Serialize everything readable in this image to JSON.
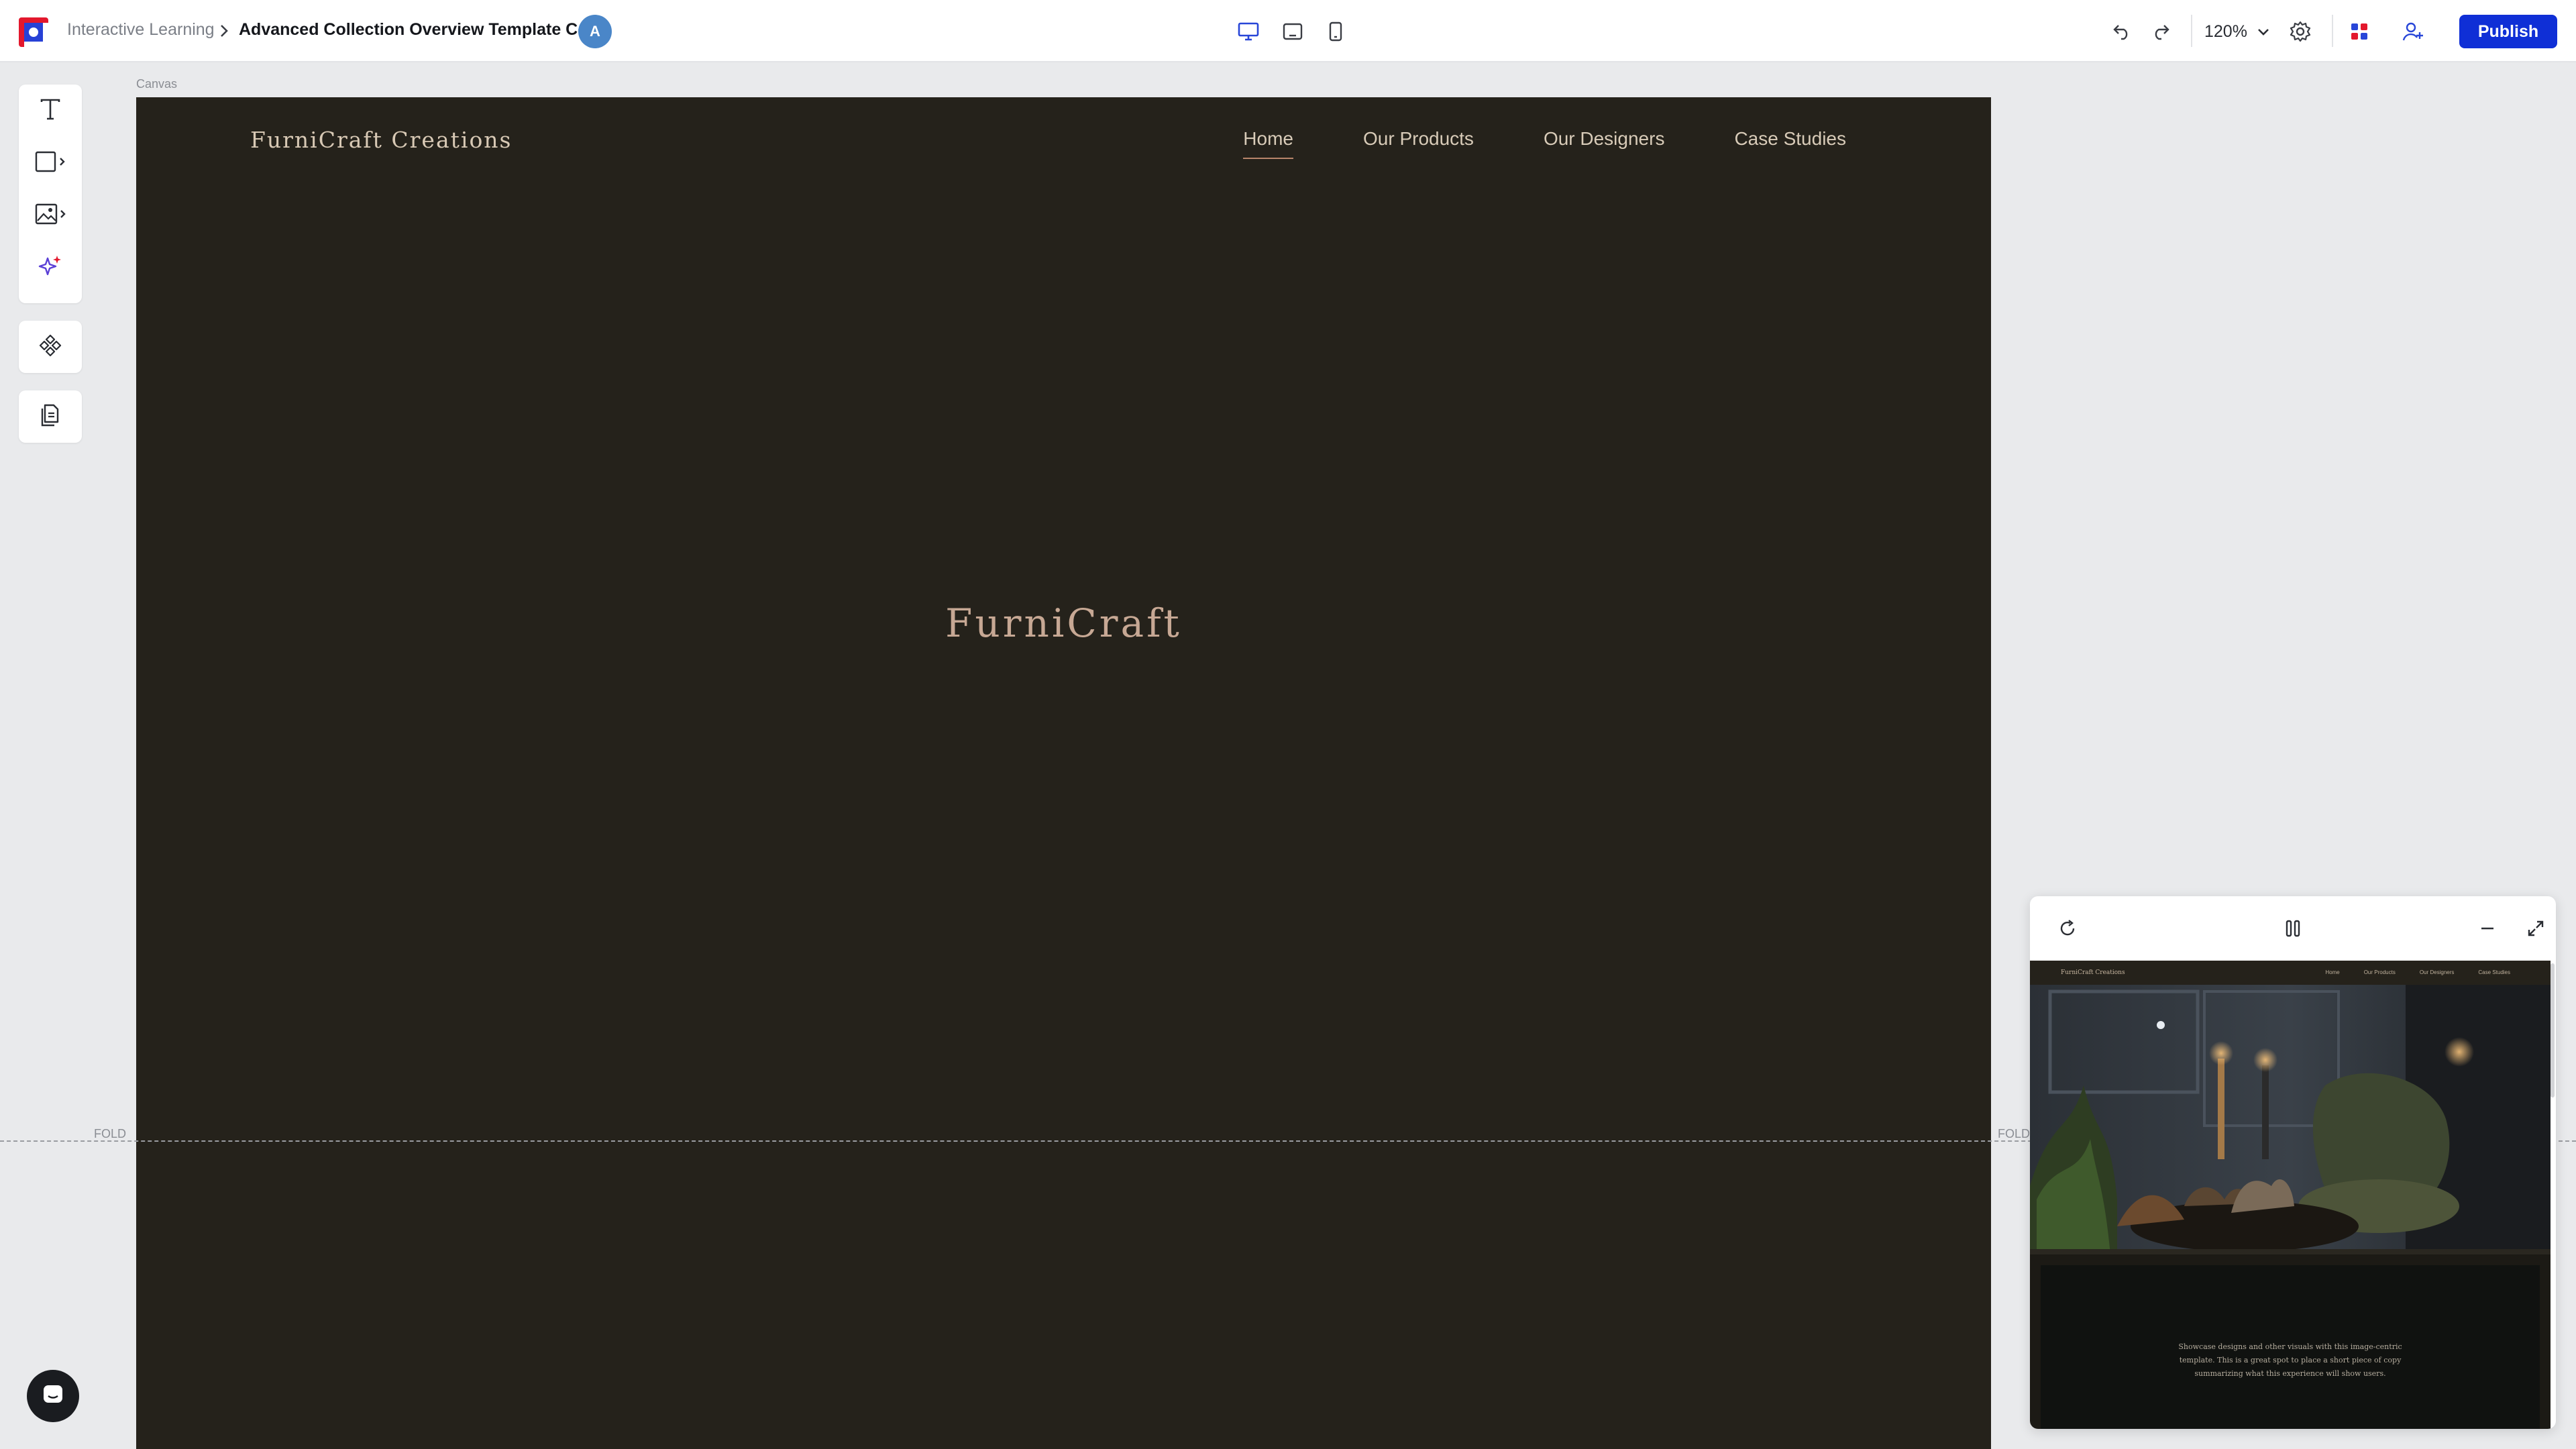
{
  "header": {
    "breadcrumb_parent": "Interactive Learning",
    "breadcrumb_current": "Advanced Collection Overview Template Copy",
    "avatar_initial": "A",
    "zoom_level": "120%",
    "publish_label": "Publish"
  },
  "canvas": {
    "label": "Canvas",
    "fold_label": "FOLD"
  },
  "site": {
    "brand": "FurniCraft Creations",
    "nav": [
      "Home",
      "Our Products",
      "Our Designers",
      "Case Studies"
    ],
    "hero_title": "FurniCraft"
  },
  "preview": {
    "brand": "FurniCraft Creations",
    "nav": [
      "Home",
      "Our Products",
      "Our Designers",
      "Case Studies"
    ],
    "body_text": "Showcase designs and other visuals with this image-centric template. This is a great spot to place a short piece of copy summarizing what this experience will show users."
  },
  "colors": {
    "accent": "#0f2fd6",
    "site_background": "#25221b",
    "hero_text": "#c7a894",
    "nav_underline": "#b8856a"
  },
  "icons": {
    "devices": [
      "desktop-icon",
      "tablet-icon",
      "mobile-icon"
    ],
    "toolbar": [
      "undo-icon",
      "redo-icon",
      "chevron-down-icon",
      "gear-icon",
      "apps-icon",
      "add-user-icon"
    ],
    "tools": [
      "text-tool-icon",
      "shape-tool-icon",
      "image-tool-icon",
      "ai-sparkle-icon",
      "components-icon",
      "pages-icon"
    ],
    "preview": [
      "refresh-icon",
      "pause-icon",
      "minimize-icon",
      "expand-icon"
    ]
  }
}
